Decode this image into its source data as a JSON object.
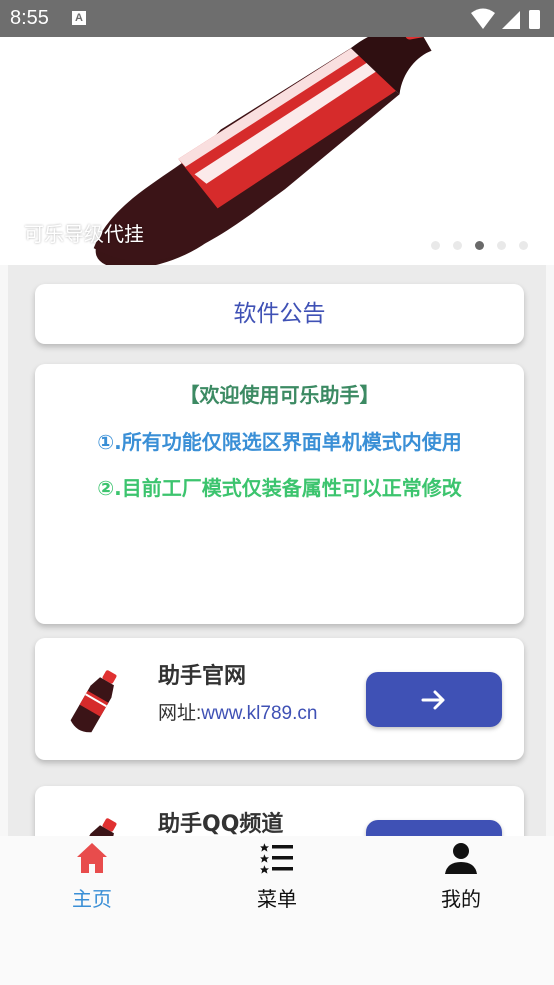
{
  "status": {
    "time": "8:55",
    "icon_a": "A"
  },
  "banner": {
    "caption": "可乐导级代挂",
    "page_count": 5,
    "active_index": 3
  },
  "notice": {
    "title": "软件公告",
    "lines": [
      "【欢迎使用可乐助手】",
      "①.所有功能仅限选区界面单机模式内使用",
      "②.目前工厂模式仅装备属性可以正常修改"
    ],
    "colors": [
      "#3c8a63",
      "#3a8fd6",
      "#3cc46e"
    ]
  },
  "links": [
    {
      "title": "助手官网",
      "url_prefix": "网址:",
      "url": "www.kl789.cn",
      "icon": "cola-bottle-icon",
      "action_icon": "arrow-right-icon"
    },
    {
      "title": "助手QQ频道",
      "icon": "cola-bottle-icon",
      "action_icon": "arrow-right-icon"
    }
  ],
  "nav": [
    {
      "label": "主页",
      "icon": "home-icon",
      "active": true
    },
    {
      "label": "菜单",
      "icon": "menu-list-icon",
      "active": false
    },
    {
      "label": "我的",
      "icon": "person-icon",
      "active": false
    }
  ],
  "colors": {
    "accent": "#3f51b5",
    "home_active": "#e84c4c",
    "nav_active_text": "#3a8fd6"
  }
}
